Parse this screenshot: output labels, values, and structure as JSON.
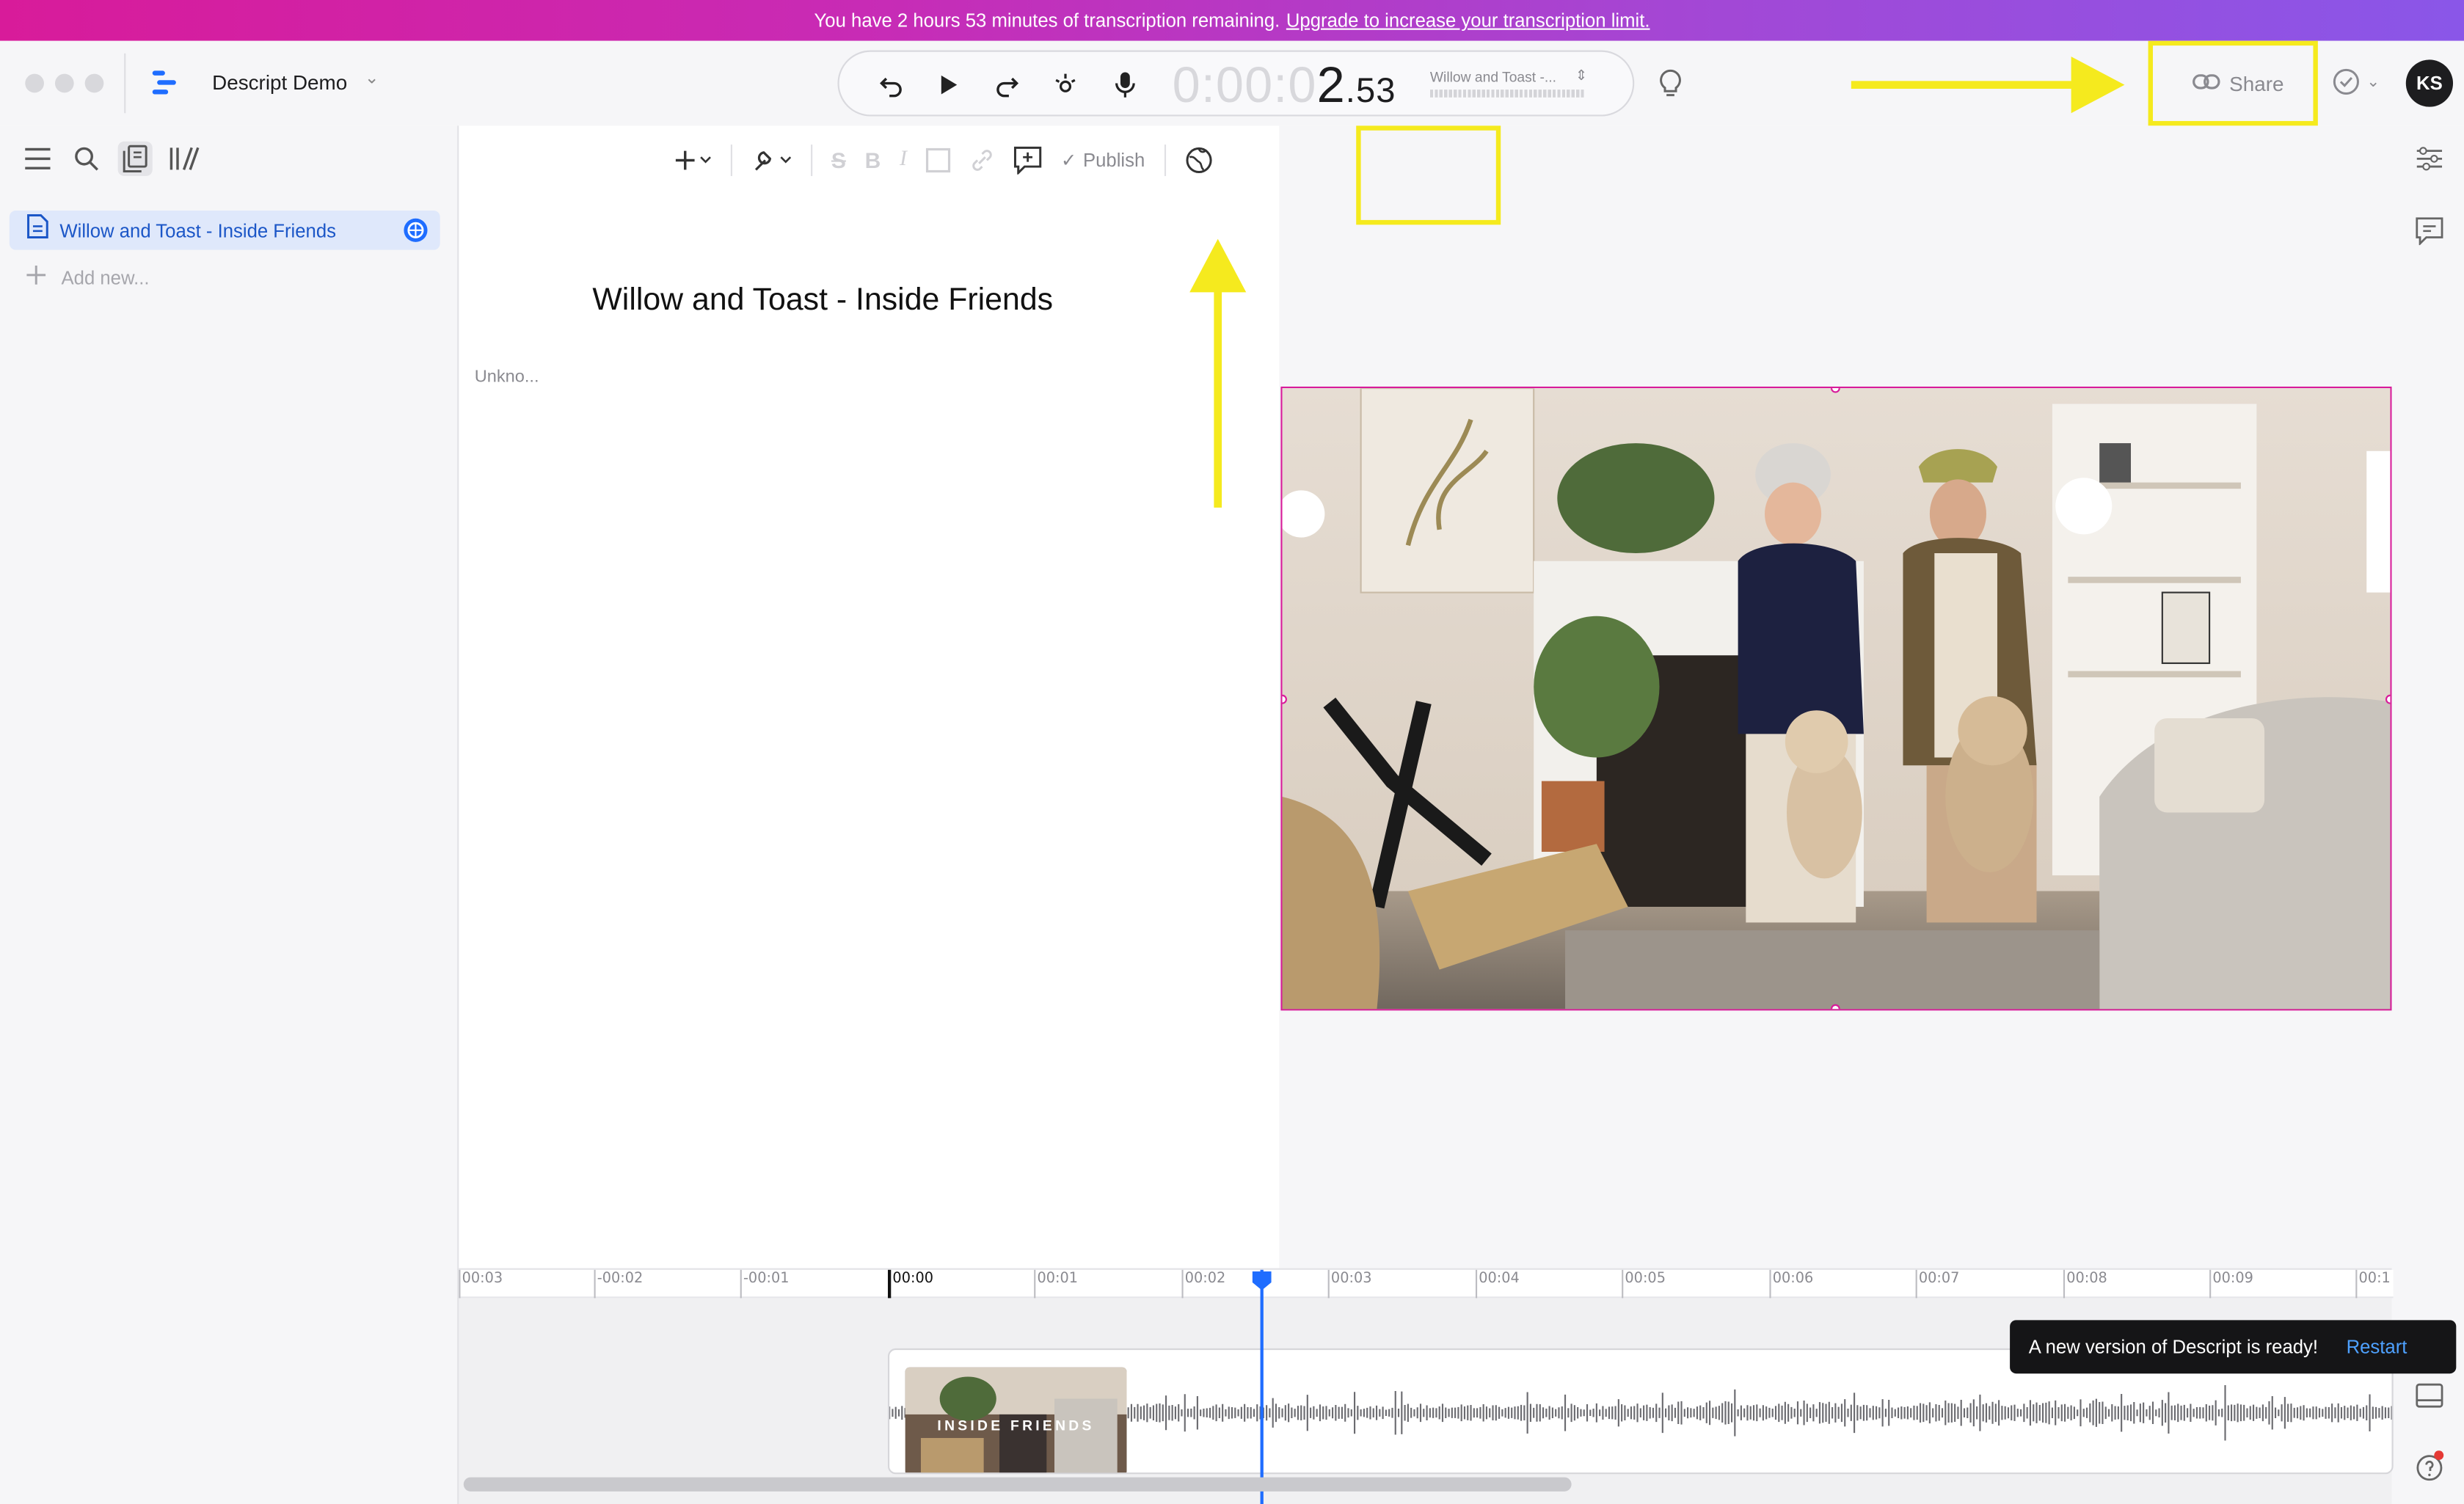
{
  "banner": {
    "text": "You have 2 hours 53 minutes of transcription remaining.",
    "link": "Upgrade to increase your transcription limit."
  },
  "titlebar": {
    "project_name": "Descript Demo",
    "timecode_dim": "0:00:0",
    "timecode_main": "2",
    "timecode_frac": ".53",
    "composition_name": "Willow and Toast -...",
    "share_label": "Share",
    "avatar_initials": "KS"
  },
  "sidebar": {
    "items": [
      {
        "label": "Willow and Toast - Inside Friends"
      }
    ],
    "add_label": "Add new..."
  },
  "toolbar": {
    "publish_label": "Publish"
  },
  "document": {
    "title": "Willow and Toast - Inside Friends",
    "speaker": "Unkno..."
  },
  "timeline": {
    "ticks": [
      "00:03",
      "-00:02",
      "-00:01",
      "00:00",
      "00:01",
      "00:02",
      "00:03",
      "00:04",
      "00:05",
      "00:06",
      "00:07",
      "00:08",
      "00:09",
      "00:1"
    ],
    "clip_title": "INSIDE FRIENDS"
  },
  "toast": {
    "message": "A new version of Descript is ready!",
    "action": "Restart"
  },
  "colors": {
    "accent_blue": "#1f6dff",
    "highlight_yellow": "#f5ea1e",
    "selection_magenta": "#d81b9a"
  }
}
